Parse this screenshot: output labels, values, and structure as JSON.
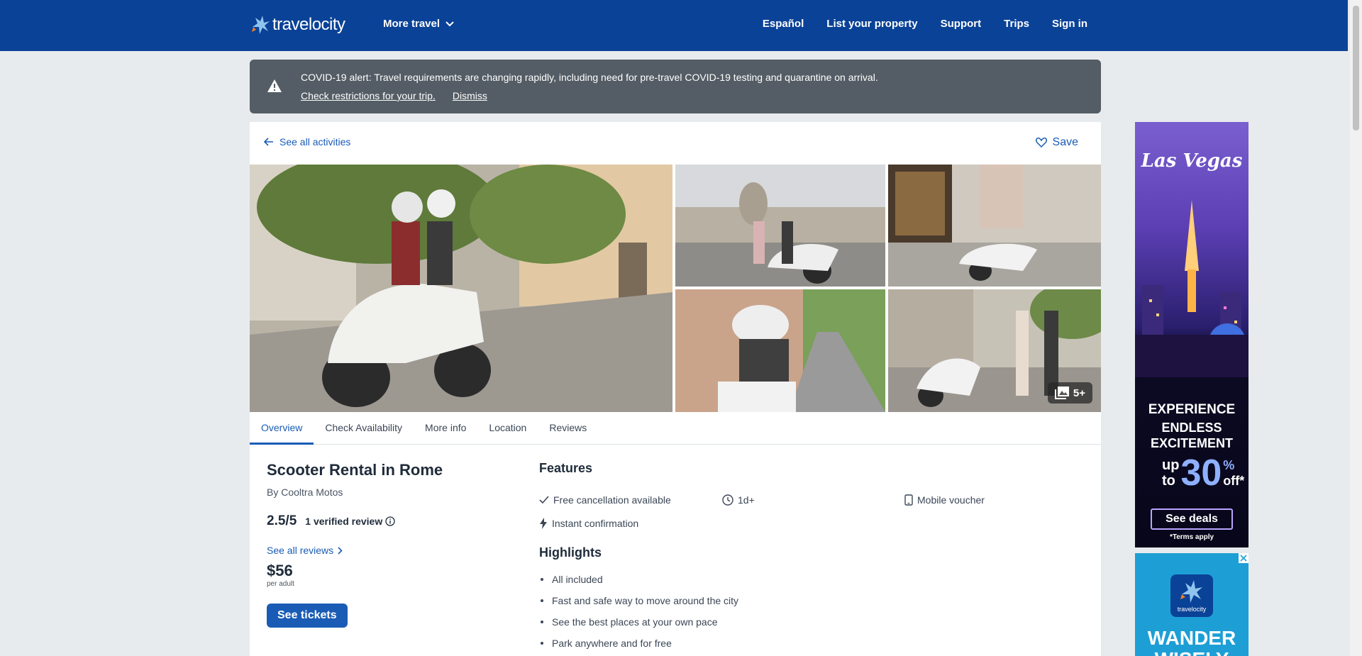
{
  "header": {
    "logo_text": "travelocity",
    "more_travel": "More travel",
    "nav": [
      "Español",
      "List your property",
      "Support",
      "Trips",
      "Sign in"
    ]
  },
  "alert": {
    "message": "COVID-19 alert: Travel requirements are changing rapidly, including need for pre-travel COVID-19 testing and quarantine on arrival.",
    "check_link": "Check restrictions for your trip.",
    "dismiss": "Dismiss"
  },
  "activity": {
    "back_link": "See all activities",
    "save": "Save",
    "more_photos": "5+",
    "tabs": [
      "Overview",
      "Check Availability",
      "More info",
      "Location",
      "Reviews"
    ],
    "active_tab": "Overview",
    "title": "Scooter Rental in Rome",
    "by": "By Cooltra Motos",
    "score": "2.5/5",
    "reviews": "1 verified review",
    "see_all_reviews": "See all reviews",
    "price": "$56",
    "per": "per adult",
    "cta": "See tickets"
  },
  "features": {
    "heading": "Features",
    "items": [
      "Free cancellation available",
      "1d+",
      "Mobile voucher",
      "Instant confirmation"
    ]
  },
  "highlights": {
    "heading": "Highlights",
    "items": [
      "All included",
      "Fast and safe way to move around the city",
      "See the best places at your own pace",
      "Park anywhere and for free"
    ]
  },
  "ads": {
    "ad1": {
      "brand": "Las Vegas",
      "line1": "EXPERIENCE",
      "line2": "ENDLESS EXCITEMENT",
      "up": "up",
      "to": "to",
      "pct": "30",
      "sym": "%",
      "off": "off*",
      "button": "See deals",
      "terms": "*Terms apply"
    },
    "ad2": {
      "logo": "travelocity",
      "line": "WANDER WISELY"
    }
  },
  "colors": {
    "brand_blue": "#0a4297",
    "link_blue": "#1a5cb5",
    "alert_gray": "#545d65"
  }
}
